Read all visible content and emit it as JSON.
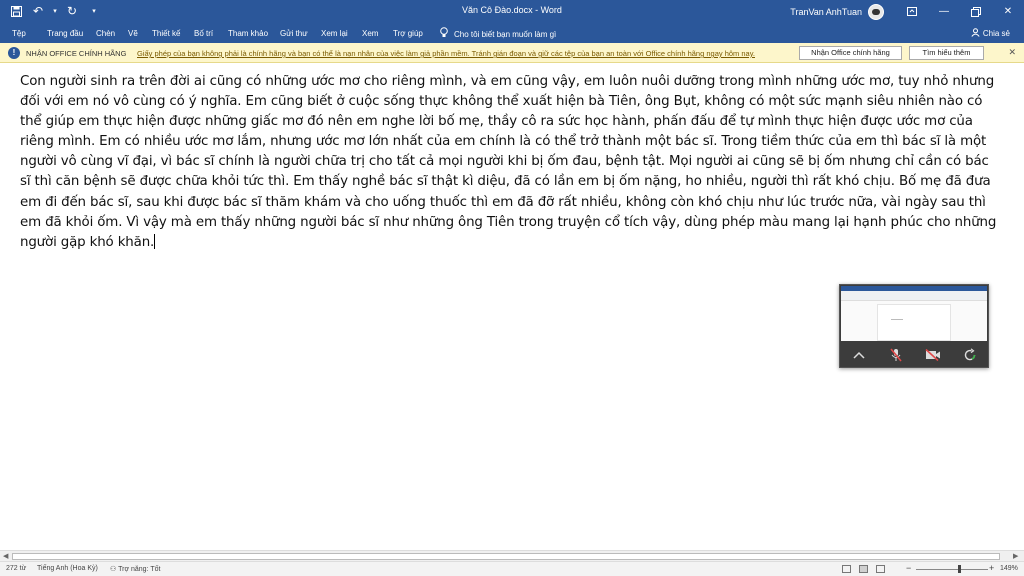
{
  "titlebar": {
    "doc_title": "Văn Cô Đào.docx  -  Word",
    "user_name": "TranVan AnhTuan"
  },
  "tabs": [
    {
      "label": "Tệp"
    },
    {
      "label": "Trang đầu"
    },
    {
      "label": "Chèn"
    },
    {
      "label": "Vẽ"
    },
    {
      "label": "Thiết kế"
    },
    {
      "label": "Bố trí"
    },
    {
      "label": "Tham khảo"
    },
    {
      "label": "Gửi thư"
    },
    {
      "label": "Xem lại"
    },
    {
      "label": "Xem"
    },
    {
      "label": "Trợ giúp"
    }
  ],
  "tell_me": "Cho tôi biết bạn muốn làm gì",
  "share_label": "Chia sẻ",
  "notice": {
    "title": "NHẬN OFFICE CHÍNH HÃNG",
    "message": "Giấy phép của bạn không phải là chính hãng và bạn có thể là nạn nhân của việc làm giả phần mềm. Tránh gián đoạn và giữ các tệp của bạn an toàn với Office chính hãng ngay hôm nay.",
    "btn_genuine": "Nhận Office chính hãng",
    "btn_learn": "Tìm hiểu thêm"
  },
  "document": {
    "text": "Con người sinh ra trên đời ai cũng có những ước mơ cho riêng mình, và em cũng vậy, em luôn nuôi dưỡng trong mình những ước mơ, tuy nhỏ nhưng đối với em nó vô cùng có ý nghĩa. Em cũng biết ở cuộc sống thực không thể xuất hiện bà Tiên, ông Bụt, không có một sức mạnh siêu nhiên nào có thể giúp em thực hiện được những giấc mơ đó nên em nghe lời bố mẹ, thầy cô ra sức học hành, phấn đấu để tự mình thực hiện được ước mơ của riêng mình. Em có nhiều ước mơ lắm, nhưng ước mơ lớn nhất của em chính là có thể trở thành một bác sĩ. Trong tiềm thức của em thì bác sĩ là một người vô cùng vĩ đại, vì bác sĩ chính là người chữa trị cho tất cả mọi người khi bị ốm đau, bệnh tật. Mọi người ai cũng sẽ bị ốm nhưng chỉ cần có bác sĩ thì căn bệnh sẽ được chữa khỏi tức thì. Em thấy nghề bác sĩ thật kì diệu, đã có lần em bị ốm nặng, ho nhiều, người thì rất khó chịu. Bố mẹ đã đưa em đi đến bác sĩ, sau khi được bác sĩ thăm khám và cho uống thuốc thì em đã đỡ rất nhiều, không còn khó chịu như lúc trước nữa, vài ngày sau thì em đã khỏi ốm. Vì vậy mà em thấy những người bác sĩ như những ông Tiên trong truyện cổ tích vậy, dùng phép màu mang lại hạnh phúc cho những người gặp khó khăn."
  },
  "status": {
    "word_count": "272 từ",
    "language": "Tiếng Anh (Hoa Kỳ)",
    "accessibility": "Trợ năng: Tốt",
    "zoom_value": "149%",
    "zoom_level": 0.6
  },
  "colors": {
    "brand": "#2b579a",
    "notice_bg": "#fdf6cb"
  }
}
